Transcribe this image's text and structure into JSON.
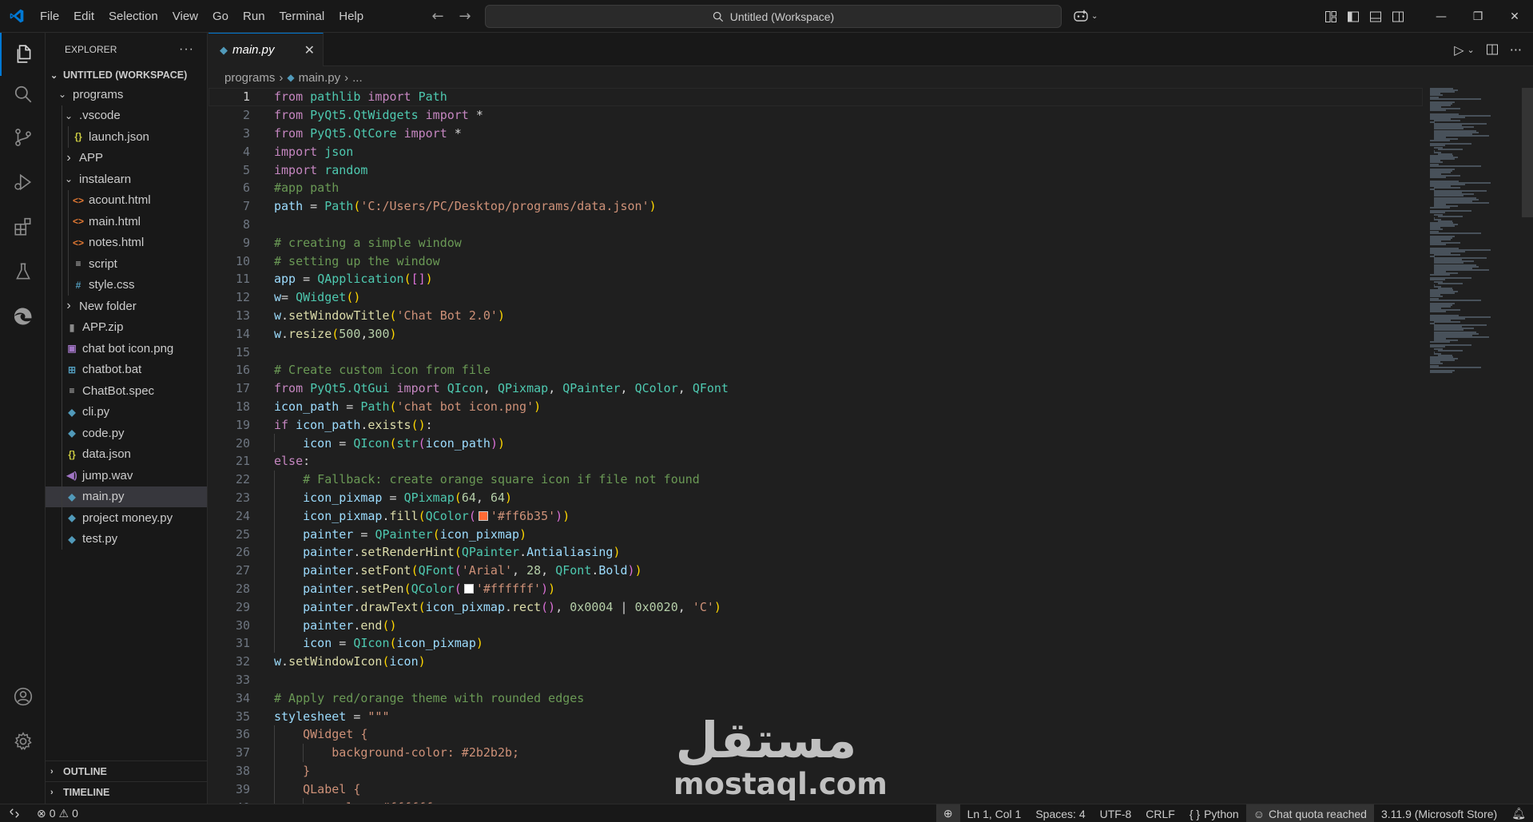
{
  "menu": [
    "File",
    "Edit",
    "Selection",
    "View",
    "Go",
    "Run",
    "Terminal",
    "Help"
  ],
  "search": {
    "label": "Untitled (Workspace)"
  },
  "colors": {
    "accent": "#0078d4",
    "vscode_logo": "#0078d4",
    "editor_bg": "#1f1f1f",
    "chrome_bg": "#181818"
  },
  "icons": {
    "activity": [
      "explorer-icon",
      "search-icon",
      "source-control-icon",
      "run-debug-icon",
      "extensions-icon",
      "testing-icon",
      "edge-icon",
      "account-icon",
      "settings-gear-icon"
    ]
  },
  "explorer": {
    "title": "EXPLORER",
    "more": "···",
    "workspace": "UNTITLED (WORKSPACE)",
    "items": [
      {
        "label": "programs",
        "kind": "folder-open",
        "depth": 0
      },
      {
        "label": ".vscode",
        "kind": "folder-open",
        "depth": 1
      },
      {
        "label": "launch.json",
        "kind": "json",
        "depth": 2
      },
      {
        "label": "APP",
        "kind": "folder",
        "depth": 1
      },
      {
        "label": "instalearn",
        "kind": "folder-open",
        "depth": 1
      },
      {
        "label": "acount.html",
        "kind": "html",
        "depth": 2
      },
      {
        "label": "main.html",
        "kind": "html",
        "depth": 2
      },
      {
        "label": "notes.html",
        "kind": "html",
        "depth": 2
      },
      {
        "label": "script",
        "kind": "text",
        "depth": 2
      },
      {
        "label": "style.css",
        "kind": "css",
        "depth": 2
      },
      {
        "label": "New folder",
        "kind": "folder",
        "depth": 1
      },
      {
        "label": "APP.zip",
        "kind": "zip",
        "depth": 1
      },
      {
        "label": "chat bot icon.png",
        "kind": "image",
        "depth": 1
      },
      {
        "label": "chatbot.bat",
        "kind": "bat",
        "depth": 1
      },
      {
        "label": "ChatBot.spec",
        "kind": "text",
        "depth": 1
      },
      {
        "label": "cli.py",
        "kind": "python",
        "depth": 1
      },
      {
        "label": "code.py",
        "kind": "python",
        "depth": 1
      },
      {
        "label": "data.json",
        "kind": "json",
        "depth": 1
      },
      {
        "label": "jump.wav",
        "kind": "audio",
        "depth": 1
      },
      {
        "label": "main.py",
        "kind": "python",
        "depth": 1,
        "selected": true
      },
      {
        "label": "project money.py",
        "kind": "python",
        "depth": 1
      },
      {
        "label": "test.py",
        "kind": "python",
        "depth": 1
      }
    ],
    "outline": "OUTLINE",
    "timeline": "TIMELINE"
  },
  "tab": {
    "label": "main.py",
    "close": "✕"
  },
  "breadcrumb": {
    "folder": "programs",
    "file": "main.py",
    "more": "..."
  },
  "code": {
    "current_line": 1,
    "lines": [
      [
        [
          "k",
          "from"
        ],
        [
          "p",
          " "
        ],
        [
          "cl",
          "pathlib"
        ],
        [
          "p",
          " "
        ],
        [
          "k",
          "import"
        ],
        [
          "p",
          " "
        ],
        [
          "cl",
          "Path"
        ]
      ],
      [
        [
          "k",
          "from"
        ],
        [
          "p",
          " "
        ],
        [
          "cl",
          "PyQt5.QtWidgets"
        ],
        [
          "p",
          " "
        ],
        [
          "k",
          "import"
        ],
        [
          "p",
          " *"
        ]
      ],
      [
        [
          "k",
          "from"
        ],
        [
          "p",
          " "
        ],
        [
          "cl",
          "PyQt5.QtCore"
        ],
        [
          "p",
          " "
        ],
        [
          "k",
          "import"
        ],
        [
          "p",
          " *"
        ]
      ],
      [
        [
          "k",
          "import"
        ],
        [
          "p",
          " "
        ],
        [
          "cl",
          "json"
        ]
      ],
      [
        [
          "k",
          "import"
        ],
        [
          "p",
          " "
        ],
        [
          "cl",
          "random"
        ]
      ],
      [
        [
          "c",
          "#app path"
        ]
      ],
      [
        [
          "v",
          "path"
        ],
        [
          "p",
          " = "
        ],
        [
          "cl",
          "Path"
        ],
        [
          "b1",
          "("
        ],
        [
          "s",
          "'C:/Users/PC/Desktop/programs/data.json'"
        ],
        [
          "b1",
          ")"
        ]
      ],
      [],
      [
        [
          "c",
          "# creating a simple window"
        ]
      ],
      [
        [
          "c",
          "# setting up the window"
        ]
      ],
      [
        [
          "v",
          "app"
        ],
        [
          "p",
          " = "
        ],
        [
          "cl",
          "QApplication"
        ],
        [
          "b1",
          "("
        ],
        [
          "b2",
          "[]"
        ],
        [
          "b1",
          ")"
        ]
      ],
      [
        [
          "v",
          "w"
        ],
        [
          "p",
          "= "
        ],
        [
          "cl",
          "QWidget"
        ],
        [
          "b1",
          "()"
        ]
      ],
      [
        [
          "v",
          "w"
        ],
        [
          "p",
          "."
        ],
        [
          "f",
          "setWindowTitle"
        ],
        [
          "b1",
          "("
        ],
        [
          "s",
          "'Chat Bot 2.0'"
        ],
        [
          "b1",
          ")"
        ]
      ],
      [
        [
          "v",
          "w"
        ],
        [
          "p",
          "."
        ],
        [
          "f",
          "resize"
        ],
        [
          "b1",
          "("
        ],
        [
          "n",
          "500"
        ],
        [
          "p",
          ","
        ],
        [
          "n",
          "300"
        ],
        [
          "b1",
          ")"
        ]
      ],
      [],
      [
        [
          "c",
          "# Create custom icon from file"
        ]
      ],
      [
        [
          "k",
          "from"
        ],
        [
          "p",
          " "
        ],
        [
          "cl",
          "PyQt5.QtGui"
        ],
        [
          "p",
          " "
        ],
        [
          "k",
          "import"
        ],
        [
          "p",
          " "
        ],
        [
          "cl",
          "QIcon"
        ],
        [
          "p",
          ", "
        ],
        [
          "cl",
          "QPixmap"
        ],
        [
          "p",
          ", "
        ],
        [
          "cl",
          "QPainter"
        ],
        [
          "p",
          ", "
        ],
        [
          "cl",
          "QColor"
        ],
        [
          "p",
          ", "
        ],
        [
          "cl",
          "QFont"
        ]
      ],
      [
        [
          "v",
          "icon_path"
        ],
        [
          "p",
          " = "
        ],
        [
          "cl",
          "Path"
        ],
        [
          "b1",
          "("
        ],
        [
          "s",
          "'chat bot icon.png'"
        ],
        [
          "b1",
          ")"
        ]
      ],
      [
        [
          "k",
          "if"
        ],
        [
          "p",
          " "
        ],
        [
          "v",
          "icon_path"
        ],
        [
          "p",
          "."
        ],
        [
          "f",
          "exists"
        ],
        [
          "b1",
          "()"
        ],
        [
          "p",
          ":"
        ]
      ],
      [
        [
          "p",
          "    "
        ],
        [
          "v",
          "icon"
        ],
        [
          "p",
          " = "
        ],
        [
          "cl",
          "QIcon"
        ],
        [
          "b1",
          "("
        ],
        [
          "cl",
          "str"
        ],
        [
          "b2",
          "("
        ],
        [
          "v",
          "icon_path"
        ],
        [
          "b2",
          ")"
        ],
        [
          "b1",
          ")"
        ]
      ],
      [
        [
          "k",
          "else"
        ],
        [
          "p",
          ":"
        ]
      ],
      [
        [
          "p",
          "    "
        ],
        [
          "c",
          "# Fallback: create orange square icon if file not found"
        ]
      ],
      [
        [
          "p",
          "    "
        ],
        [
          "v",
          "icon_pixmap"
        ],
        [
          "p",
          " = "
        ],
        [
          "cl",
          "QPixmap"
        ],
        [
          "b1",
          "("
        ],
        [
          "n",
          "64"
        ],
        [
          "p",
          ", "
        ],
        [
          "n",
          "64"
        ],
        [
          "b1",
          ")"
        ]
      ],
      [
        [
          "p",
          "    "
        ],
        [
          "v",
          "icon_pixmap"
        ],
        [
          "p",
          "."
        ],
        [
          "f",
          "fill"
        ],
        [
          "b1",
          "("
        ],
        [
          "cl",
          "QColor"
        ],
        [
          "b2",
          "("
        ],
        [
          "sw",
          "#ff6b35"
        ],
        [
          "s",
          "'#ff6b35'"
        ],
        [
          "b2",
          ")"
        ],
        [
          "b1",
          ")"
        ]
      ],
      [
        [
          "p",
          "    "
        ],
        [
          "v",
          "painter"
        ],
        [
          "p",
          " = "
        ],
        [
          "cl",
          "QPainter"
        ],
        [
          "b1",
          "("
        ],
        [
          "v",
          "icon_pixmap"
        ],
        [
          "b1",
          ")"
        ]
      ],
      [
        [
          "p",
          "    "
        ],
        [
          "v",
          "painter"
        ],
        [
          "p",
          "."
        ],
        [
          "f",
          "setRenderHint"
        ],
        [
          "b1",
          "("
        ],
        [
          "cl",
          "QPainter"
        ],
        [
          "p",
          "."
        ],
        [
          "v",
          "Antialiasing"
        ],
        [
          "b1",
          ")"
        ]
      ],
      [
        [
          "p",
          "    "
        ],
        [
          "v",
          "painter"
        ],
        [
          "p",
          "."
        ],
        [
          "f",
          "setFont"
        ],
        [
          "b1",
          "("
        ],
        [
          "cl",
          "QFont"
        ],
        [
          "b2",
          "("
        ],
        [
          "s",
          "'Arial'"
        ],
        [
          "p",
          ", "
        ],
        [
          "n",
          "28"
        ],
        [
          "p",
          ", "
        ],
        [
          "cl",
          "QFont"
        ],
        [
          "p",
          "."
        ],
        [
          "v",
          "Bold"
        ],
        [
          "b2",
          ")"
        ],
        [
          "b1",
          ")"
        ]
      ],
      [
        [
          "p",
          "    "
        ],
        [
          "v",
          "painter"
        ],
        [
          "p",
          "."
        ],
        [
          "f",
          "setPen"
        ],
        [
          "b1",
          "("
        ],
        [
          "cl",
          "QColor"
        ],
        [
          "b2",
          "("
        ],
        [
          "sw",
          "#ffffff"
        ],
        [
          "s",
          "'#ffffff'"
        ],
        [
          "b2",
          ")"
        ],
        [
          "b1",
          ")"
        ]
      ],
      [
        [
          "p",
          "    "
        ],
        [
          "v",
          "painter"
        ],
        [
          "p",
          "."
        ],
        [
          "f",
          "drawText"
        ],
        [
          "b1",
          "("
        ],
        [
          "v",
          "icon_pixmap"
        ],
        [
          "p",
          "."
        ],
        [
          "f",
          "rect"
        ],
        [
          "b2",
          "()"
        ],
        [
          "p",
          ", "
        ],
        [
          "n",
          "0x0004"
        ],
        [
          "p",
          " | "
        ],
        [
          "n",
          "0x0020"
        ],
        [
          "p",
          ", "
        ],
        [
          "s",
          "'C'"
        ],
        [
          "b1",
          ")"
        ]
      ],
      [
        [
          "p",
          "    "
        ],
        [
          "v",
          "painter"
        ],
        [
          "p",
          "."
        ],
        [
          "f",
          "end"
        ],
        [
          "b1",
          "()"
        ]
      ],
      [
        [
          "p",
          "    "
        ],
        [
          "v",
          "icon"
        ],
        [
          "p",
          " = "
        ],
        [
          "cl",
          "QIcon"
        ],
        [
          "b1",
          "("
        ],
        [
          "v",
          "icon_pixmap"
        ],
        [
          "b1",
          ")"
        ]
      ],
      [
        [
          "v",
          "w"
        ],
        [
          "p",
          "."
        ],
        [
          "f",
          "setWindowIcon"
        ],
        [
          "b1",
          "("
        ],
        [
          "v",
          "icon"
        ],
        [
          "b1",
          ")"
        ]
      ],
      [],
      [
        [
          "c",
          "# Apply red/orange theme with rounded edges"
        ]
      ],
      [
        [
          "v",
          "stylesheet"
        ],
        [
          "p",
          " = "
        ],
        [
          "s",
          "\"\"\""
        ]
      ],
      [
        [
          "p",
          "    "
        ],
        [
          "s",
          "QWidget {"
        ]
      ],
      [
        [
          "p",
          "        "
        ],
        [
          "s",
          "background-color: #2b2b2b;"
        ]
      ],
      [
        [
          "p",
          "    "
        ],
        [
          "s",
          "}"
        ]
      ],
      [
        [
          "p",
          "    "
        ],
        [
          "s",
          "QLabel {"
        ]
      ],
      [
        [
          "p",
          "        "
        ],
        [
          "s",
          "color: #ffffff;"
        ]
      ]
    ]
  },
  "watermark": {
    "arabic": "مستقل",
    "latin": "mostaql.com"
  },
  "status": {
    "problems_errors": "0",
    "problems_warnings": "0",
    "position": "Ln 1, Col 1",
    "spaces": "Spaces: 4",
    "encoding": "UTF-8",
    "eol": "CRLF",
    "language": "Python",
    "chat": "Chat quota reached",
    "interpreter": "3.11.9 (Microsoft Store)"
  }
}
